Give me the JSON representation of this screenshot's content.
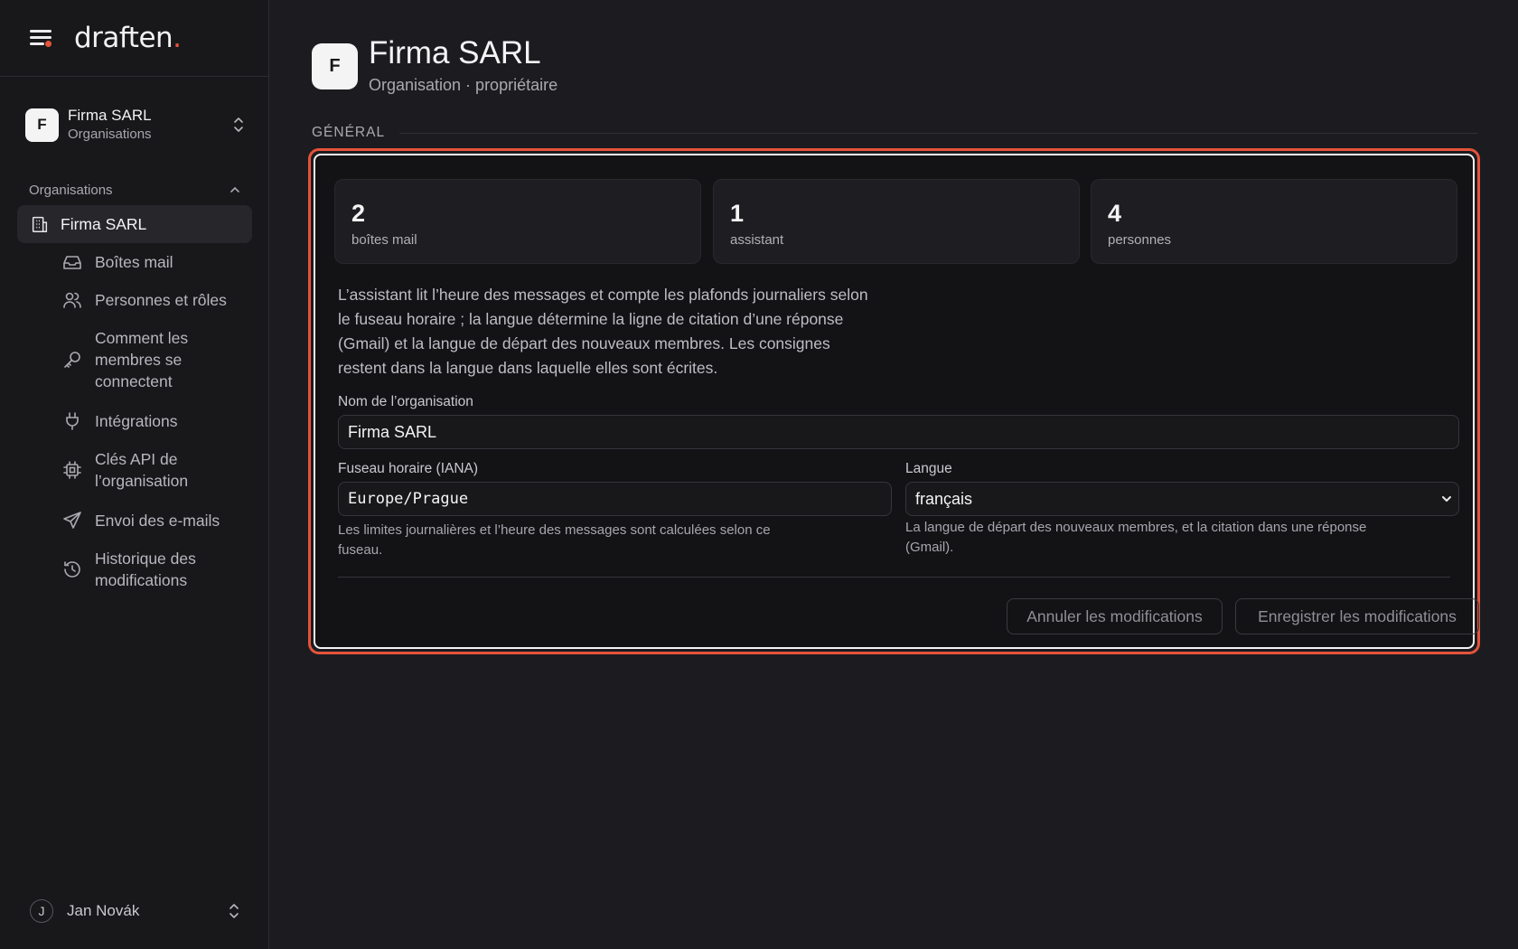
{
  "brand": {
    "name": "draften",
    "dot": ".",
    "accent": "#e5533b"
  },
  "sidebar": {
    "org_switch": {
      "initial": "F",
      "name": "Firma SARL",
      "subtitle": "Organisations"
    },
    "section_title": "Organisations",
    "active_item": "Firma SARL",
    "items": [
      {
        "label": "Boîtes mail",
        "icon": "inbox-icon"
      },
      {
        "label": "Personnes et rôles",
        "icon": "users-icon"
      },
      {
        "label": "Comment les membres se connectent",
        "icon": "key-icon"
      },
      {
        "label": "Intégrations",
        "icon": "plug-icon"
      },
      {
        "label": "Clés API de l’organisation",
        "icon": "cpu-icon"
      },
      {
        "label": "Envoi des e-mails",
        "icon": "send-icon"
      },
      {
        "label": "Historique des modifications",
        "icon": "history-icon"
      }
    ],
    "user": {
      "initial": "J",
      "name": "Jan Novák"
    }
  },
  "header": {
    "initial": "F",
    "title": "Firma SARL",
    "subtitle": "Organisation · propriétaire"
  },
  "general": {
    "section_label": "GÉNÉRAL",
    "stats": [
      {
        "value": "2",
        "label": "boîtes mail"
      },
      {
        "value": "1",
        "label": "assistant"
      },
      {
        "value": "4",
        "label": "personnes"
      }
    ],
    "description": "L’assistant lit l’heure des messages et compte les plafonds journaliers selon le fuseau horaire ; la langue détermine la ligne de citation d’une réponse (Gmail) et la langue de départ des nouveaux membres. Les consignes restent dans la langue dans laquelle elles sont écrites.",
    "org_name_label": "Nom de l’organisation",
    "org_name_value": "Firma SARL",
    "timezone_label": "Fuseau horaire (IANA)",
    "timezone_value": "Europe/Prague",
    "timezone_hint": "Les limites journalières et l’heure des messages sont calculées selon ce fuseau.",
    "language_label": "Langue",
    "language_value": "français",
    "language_hint": "La langue de départ des nouveaux membres, et la citation dans une réponse (Gmail).",
    "cancel_label": "Annuler les modifications",
    "save_label": "Enregistrer les modifications"
  }
}
